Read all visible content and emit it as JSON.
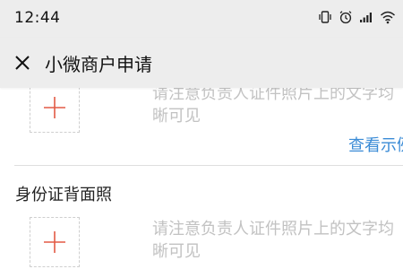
{
  "status_bar": {
    "time": "12:44",
    "icons": [
      "vibrate-icon",
      "alarm-icon",
      "cellular-signal-icon",
      "wifi-icon"
    ]
  },
  "header": {
    "title": "小微商户申请",
    "close_icon": "close-icon"
  },
  "front_section": {
    "hint_line1": "请注意负责人证件照片上的文字均",
    "hint_line2": "晰可见",
    "example_link": "查看示例"
  },
  "back_section": {
    "title": "身份证背面照",
    "hint_line1": "请注意负责人证件照片上的文字均",
    "hint_line2": "晰可见"
  },
  "colors": {
    "plus": "#e35a45",
    "link": "#3a8bd6",
    "hint": "#c2c2c2",
    "bar_bg": "#ededed"
  }
}
